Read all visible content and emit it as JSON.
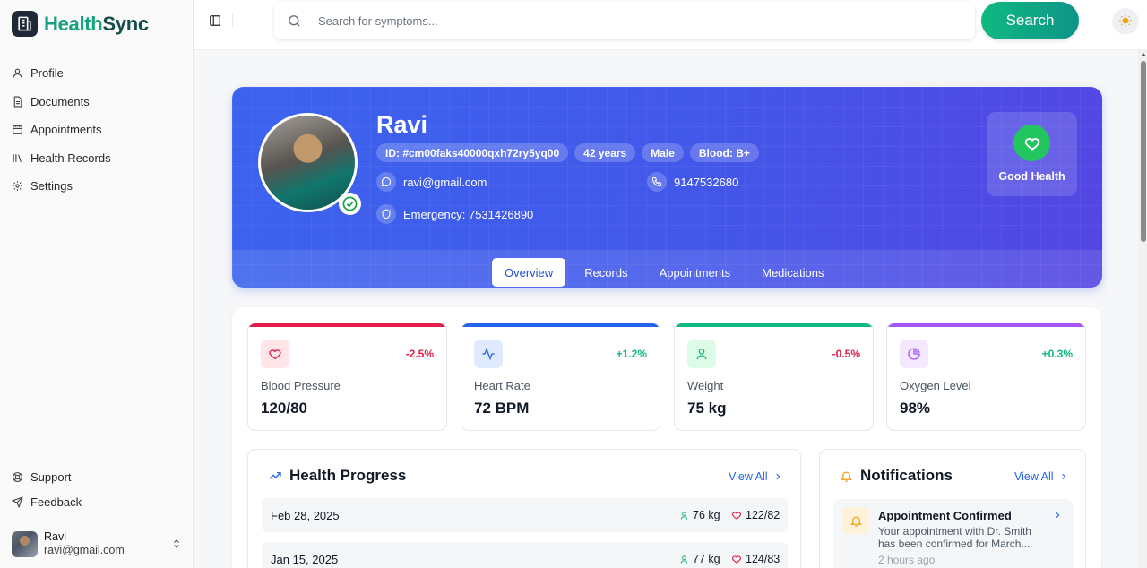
{
  "brand": {
    "part1": "Health",
    "part2": "Sync"
  },
  "sidebar": {
    "items": [
      {
        "label": "Profile",
        "icon": "user-icon"
      },
      {
        "label": "Documents",
        "icon": "document-icon"
      },
      {
        "label": "Appointments",
        "icon": "calendar-icon"
      },
      {
        "label": "Health Records",
        "icon": "library-icon"
      },
      {
        "label": "Settings",
        "icon": "gear-icon"
      }
    ],
    "bottom": [
      {
        "label": "Support",
        "icon": "lifebuoy-icon"
      },
      {
        "label": "Feedback",
        "icon": "send-icon"
      }
    ],
    "user": {
      "name": "Ravi",
      "email": "ravi@gmail.com"
    }
  },
  "search": {
    "placeholder": "Search for symptoms...",
    "button": "Search"
  },
  "profile": {
    "name": "Ravi",
    "id": "ID: #cm00faks40000qxh72ry5yq00",
    "age": "42 years",
    "gender": "Male",
    "blood": "Blood: B+",
    "email": "ravi@gmail.com",
    "phone": "9147532680",
    "emergency": "Emergency: 7531426890",
    "status": "Good Health"
  },
  "tabs": [
    "Overview",
    "Records",
    "Appointments",
    "Medications"
  ],
  "stats": [
    {
      "label": "Blood Pressure",
      "value": "120/80",
      "change": "-2.5%",
      "color": "#e11d48",
      "icon": "heart-icon"
    },
    {
      "label": "Heart Rate",
      "value": "72 BPM",
      "change": "+1.2%",
      "color": "#2563eb",
      "icon": "activity-icon"
    },
    {
      "label": "Weight",
      "value": "75 kg",
      "change": "-0.5%",
      "color": "#10b981",
      "icon": "user-icon"
    },
    {
      "label": "Oxygen Level",
      "value": "98%",
      "change": "+0.3%",
      "color": "#a855f7",
      "icon": "pie-icon"
    }
  ],
  "progress": {
    "title": "Health Progress",
    "view_all": "View All",
    "rows": [
      {
        "date": "Feb 28, 2025",
        "weight": "76 kg",
        "bp": "122/82"
      },
      {
        "date": "Jan 15, 2025",
        "weight": "77 kg",
        "bp": "124/83"
      }
    ]
  },
  "notifications": {
    "title": "Notifications",
    "view_all": "View All",
    "items": [
      {
        "title": "Appointment Confirmed",
        "body": "Your appointment with Dr. Smith has been confirmed for March...",
        "time": "2 hours ago"
      }
    ]
  }
}
